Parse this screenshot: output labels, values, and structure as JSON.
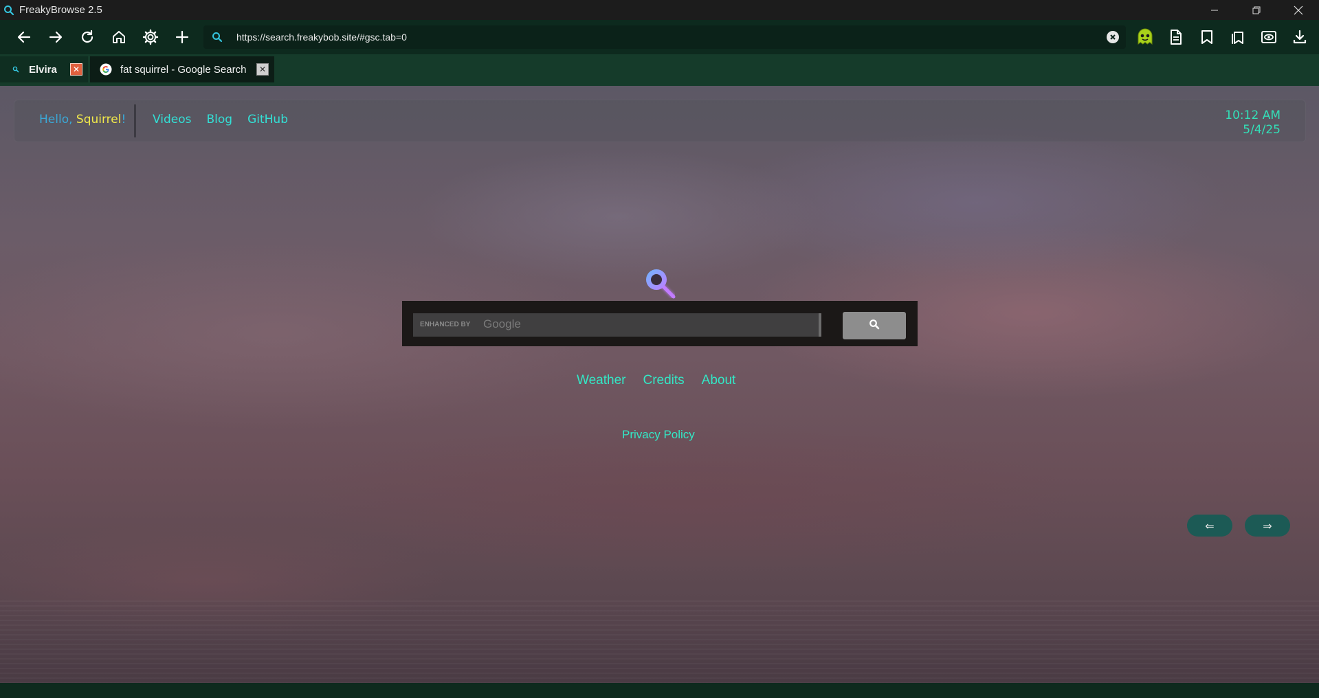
{
  "window": {
    "title": "FreakyBrowse 2.5"
  },
  "toolbar": {
    "url": "https://search.freakybob.site/#gsc.tab=0"
  },
  "tabs": [
    {
      "label": "Elvira",
      "active": false
    },
    {
      "label": "fat squirrel - Google Search",
      "active": true
    }
  ],
  "page": {
    "greeting": {
      "prefix": "Hello, ",
      "user": "Squirrel",
      "suffix": "!"
    },
    "nav": [
      "Videos",
      "Blog",
      "GitHub"
    ],
    "clock": {
      "time": "10:12 AM",
      "date": "5/4/25"
    },
    "search": {
      "enhanced_label": "ENHANCED BY",
      "provider": "Google"
    },
    "links": [
      "Weather",
      "Credits",
      "About"
    ],
    "privacy": "Privacy Policy",
    "arrows": {
      "prev": "⇐",
      "next": "⇒"
    }
  },
  "colors": {
    "accent": "#33e8c6",
    "greeting": "#3ba8d6",
    "username": "#f0e84a",
    "toolbar_bg": "#0d2a1e",
    "tabstrip_bg": "#153b2a"
  }
}
